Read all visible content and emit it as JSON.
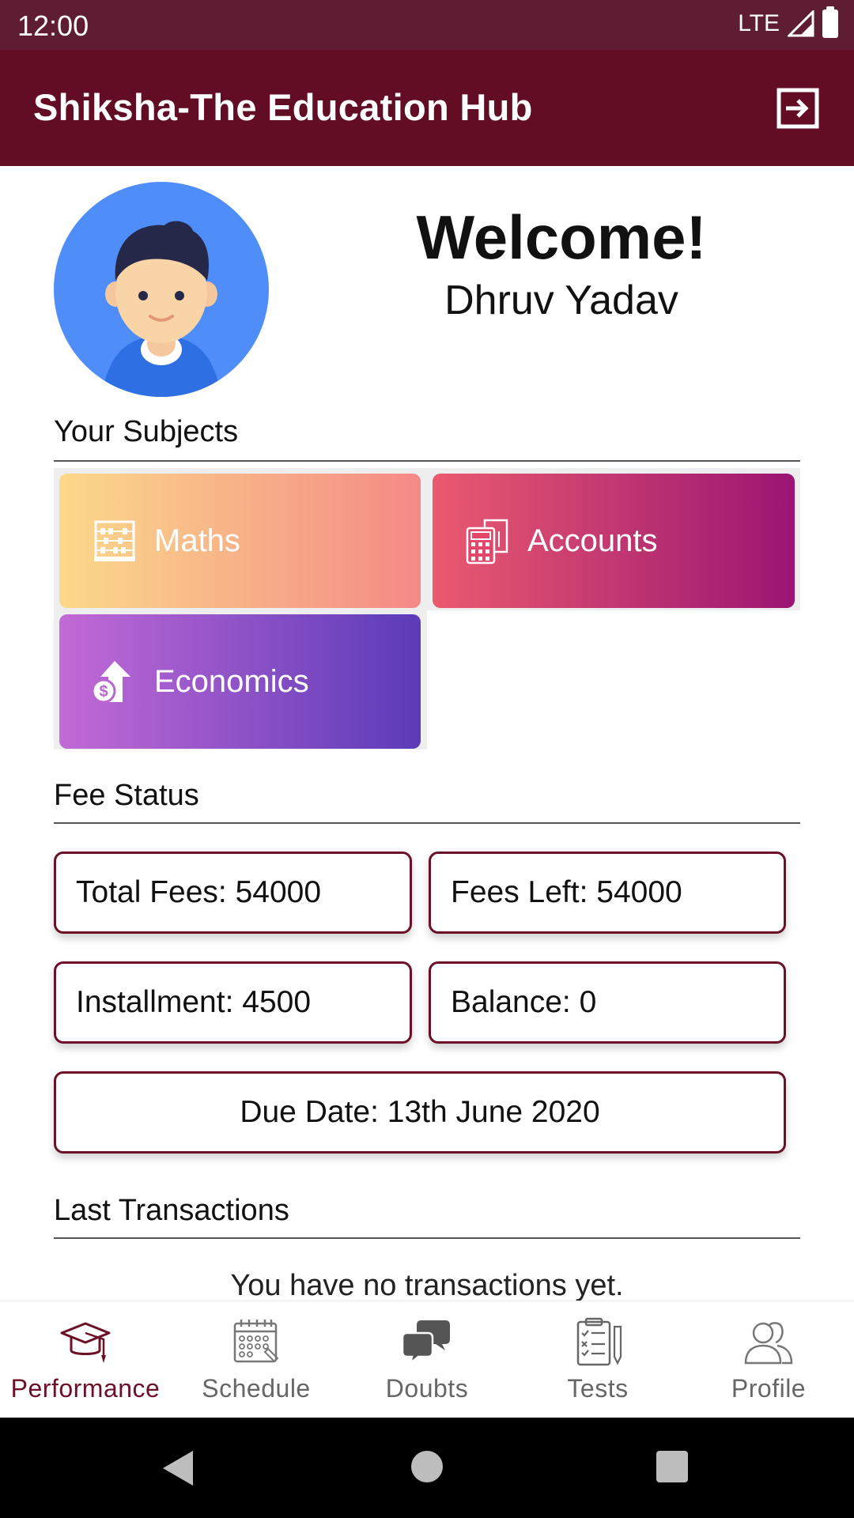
{
  "status_bar": {
    "time": "12:00",
    "network": "LTE"
  },
  "app_bar": {
    "title": "Shiksha-The Education Hub",
    "logout_icon": "logout-icon"
  },
  "welcome": {
    "heading": "Welcome!",
    "name": "Dhruv Yadav"
  },
  "subjects": {
    "title": "Your Subjects",
    "items": [
      {
        "label": "Maths",
        "icon": "abacus-icon",
        "gradient": [
          "#fbd98a",
          "#f48a86"
        ]
      },
      {
        "label": "Accounts",
        "icon": "calculator-icon",
        "gradient": [
          "#ea5a6f",
          "#9a1573"
        ]
      },
      {
        "label": "Economics",
        "icon": "money-growth-icon",
        "gradient": [
          "#c26ad6",
          "#5b3bb8"
        ]
      }
    ]
  },
  "fee_status": {
    "title": "Fee Status",
    "total_fees": "Total Fees: 54000",
    "fees_left": "Fees Left: 54000",
    "installment": "Installment: 4500",
    "balance": "Balance: 0",
    "due_date": "Due Date: 13th June 2020"
  },
  "transactions": {
    "title": "Last Transactions",
    "empty_text": "You have no transactions yet."
  },
  "bottom_nav": {
    "items": [
      {
        "label": "Performance",
        "icon": "graduation-cap-icon",
        "active": true
      },
      {
        "label": "Schedule",
        "icon": "calendar-icon",
        "active": false
      },
      {
        "label": "Doubts",
        "icon": "chat-bubbles-icon",
        "active": false
      },
      {
        "label": "Tests",
        "icon": "clipboard-checklist-icon",
        "active": false
      },
      {
        "label": "Profile",
        "icon": "users-icon",
        "active": false
      }
    ]
  },
  "colors": {
    "primary": "#620d24",
    "status_bar": "#5e1d33",
    "accent_border": "#6b1026",
    "avatar_bg": "#4f8ef9"
  }
}
